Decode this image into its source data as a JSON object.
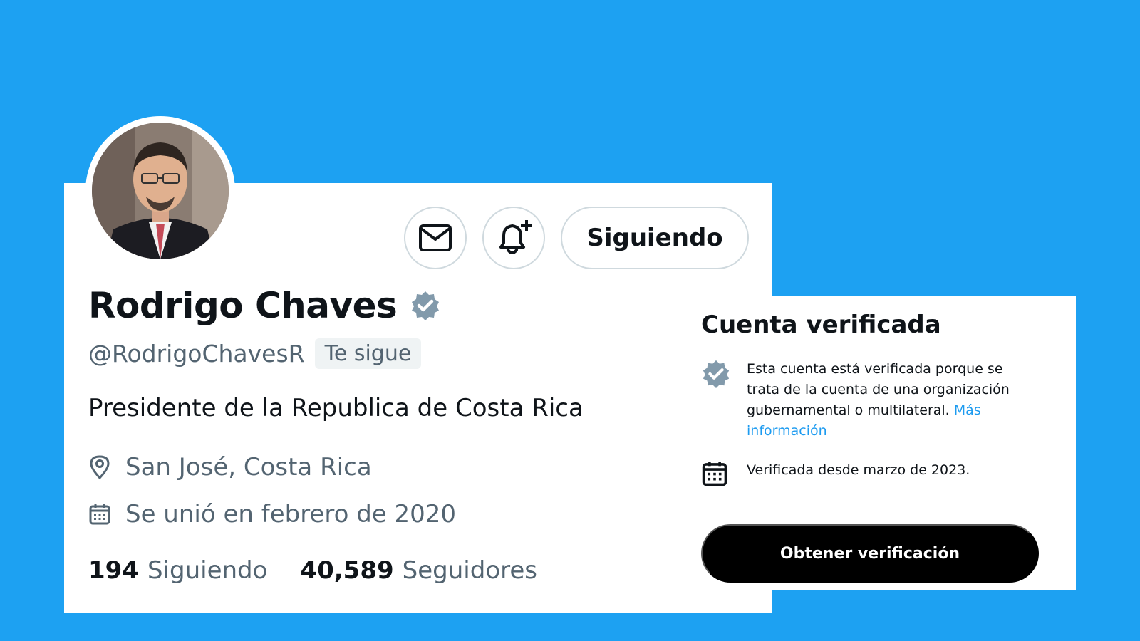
{
  "profile": {
    "display_name": "Rodrigo Chaves",
    "handle": "@RodrigoChavesR",
    "follows_you_badge": "Te sigue",
    "bio": "Presidente de la Republica de Costa Rica",
    "location": "San José, Costa Rica",
    "joined": "Se unió en febrero de 2020",
    "following_count": "194",
    "following_label": "Siguiendo",
    "followers_count": "40,589",
    "followers_label": "Seguidores",
    "verified_badge_color": "#829AAB"
  },
  "actions": {
    "message_icon": "envelope-icon",
    "notify_icon": "bell-plus-icon",
    "following_button_label": "Siguiendo"
  },
  "verification_panel": {
    "title": "Cuenta verificada",
    "description": "Esta cuenta está verificada porque se trata de la cuenta de una organización gubernamental o multilateral.",
    "more_info_link": "Más información",
    "verified_since": "Verificada desde marzo de 2023.",
    "cta_label": "Obtener verificación"
  },
  "colors": {
    "background": "#1DA1F2",
    "link": "#1D9BF0",
    "secondary_text": "#536471",
    "cta_background": "#000000"
  }
}
